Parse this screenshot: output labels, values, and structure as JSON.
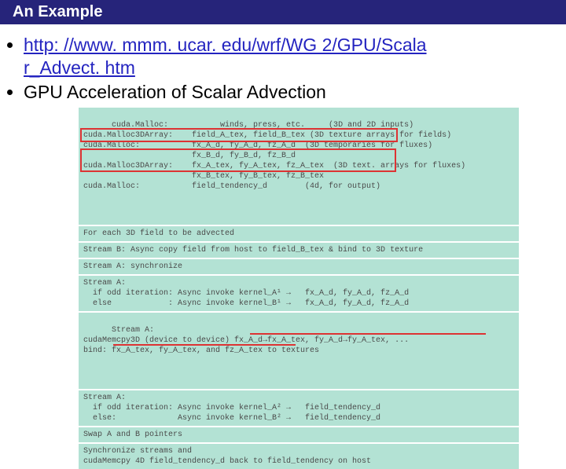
{
  "title": "An Example",
  "bullets": {
    "link_line1": "http: //www. mmm. ucar. edu/wrf/WG 2/GPU/Scala",
    "link_line2": "r_Advect. htm",
    "point2": "GPU Acceleration of Scalar Advection"
  },
  "code": {
    "block1": "cuda.Malloc:           winds, press, etc.     (3D and 2D inputs)\ncuda.Malloc3DArray:    field_A_tex, field_B_tex (3D texture arrays for fields)\ncuda.Malloc:           fx_A_d, fy_A_d, fz_A_d  (3D temporaries for fluxes)\n                       fx_B_d, fy_B_d, fz_B_d\ncuda.Malloc3DArray:    fx_A_tex, fy_A_tex, fz_A_tex  (3D text. arrays for fluxes)\n                       fx_B_tex, fy_B_tex, fz_B_tex\ncuda.Malloc:           field_tendency_d        (4d, for output)",
    "block2": "For each 3D field to be advected",
    "block3": "Stream B: Async copy field from host to field_B_tex & bind to 3D texture",
    "block4": "Stream A: synchronize",
    "block5": "Stream A:\n  if odd iteration: Async invoke kernel_A¹ →   fx_A_d, fy_A_d, fz_A_d\n  else            : Async invoke kernel_B¹ →   fx_A_d, fy_A_d, fz_A_d",
    "block6": "Stream A:\ncudaMemcpy3D (device to device) fx_A_d→fx_A_tex, fy_A_d→fy_A_tex, ...\nbind: fx_A_tex, fy_A_tex, and fz_A_tex to textures",
    "block7": "Stream A:\n  if odd iteration: Async invoke kernel_A² →   field_tendency_d\n  else:             Async invoke kernel_B² →   field_tendency_d",
    "block8": "Swap A and B pointers",
    "block9": "Synchronize streams and\ncudaMemcpy 4D field_tendency_d back to field_tendency on host"
  }
}
